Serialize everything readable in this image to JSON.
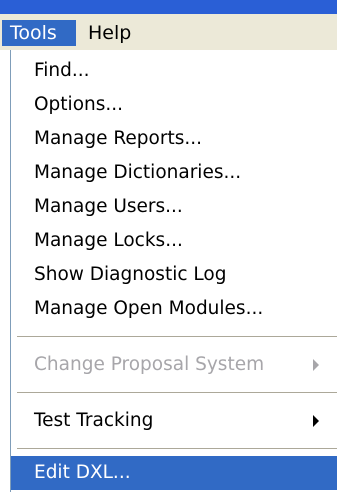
{
  "menubar": {
    "items": [
      {
        "label": "Tools",
        "active": true
      },
      {
        "label": "Help",
        "active": false
      }
    ]
  },
  "menu": {
    "items": [
      {
        "label": "Find...",
        "enabled": true
      },
      {
        "label": "Options...",
        "enabled": true
      },
      {
        "label": "Manage Reports...",
        "enabled": true
      },
      {
        "label": "Manage Dictionaries...",
        "enabled": true
      },
      {
        "label": "Manage Users...",
        "enabled": true
      },
      {
        "label": "Manage Locks...",
        "enabled": true
      },
      {
        "label": "Show Diagnostic Log",
        "enabled": true
      },
      {
        "label": "Manage Open Modules...",
        "enabled": true
      },
      {
        "label": "Change Proposal System",
        "enabled": false,
        "submenu": true
      },
      {
        "label": "Test Tracking",
        "enabled": true,
        "submenu": true
      },
      {
        "label": "Edit DXL...",
        "enabled": true,
        "highlighted": true
      }
    ]
  },
  "colors": {
    "highlight": "#316ac5",
    "menubar_bg": "#ece9d8",
    "disabled_text": "#a7a6aa"
  }
}
